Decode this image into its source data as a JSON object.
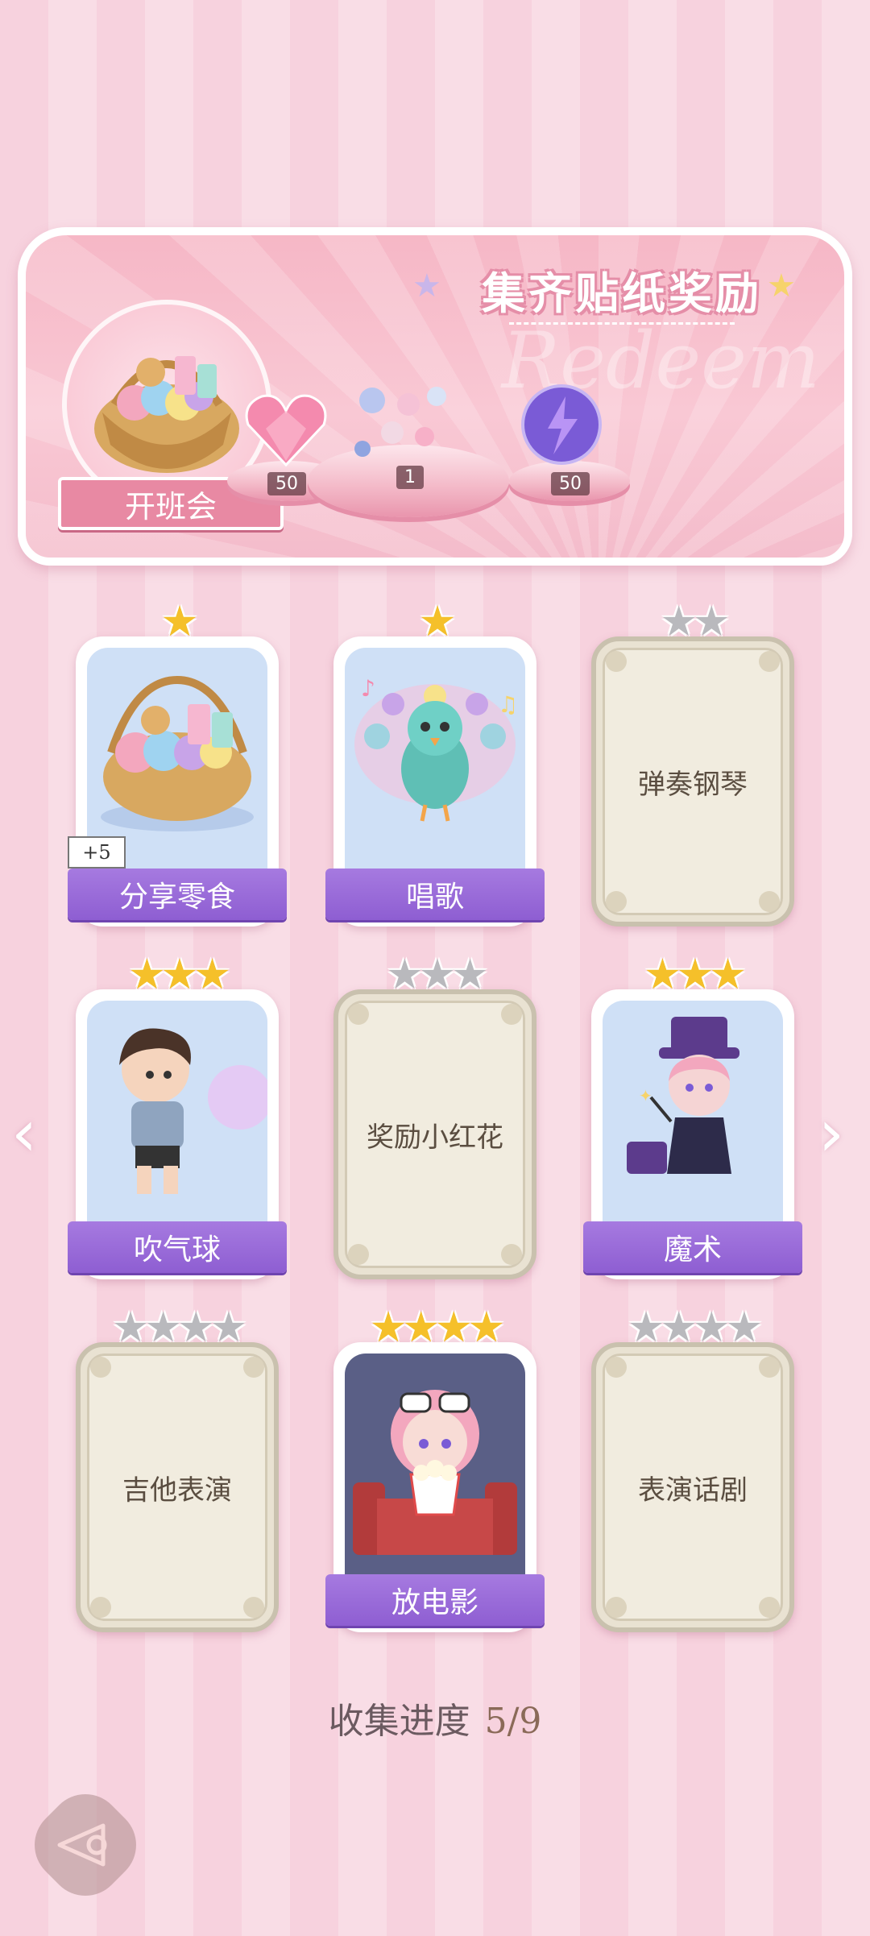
{
  "banner": {
    "title": "集齐贴纸奖励",
    "watermark": "Redeem",
    "event_label": "开班会",
    "rewards": [
      {
        "icon": "heart-gem-icon",
        "count": "50"
      },
      {
        "icon": "candy-bundle-icon",
        "count": "1"
      },
      {
        "icon": "energy-orb-icon",
        "count": "50"
      }
    ]
  },
  "cards": [
    {
      "label": "分享零食",
      "stars": 1,
      "total_stars": 1,
      "unlocked": true,
      "badge": "+5",
      "icon": "snack-basket-icon"
    },
    {
      "label": "唱歌",
      "stars": 1,
      "total_stars": 1,
      "unlocked": true,
      "icon": "singing-peacock-icon"
    },
    {
      "label": "弹奏钢琴",
      "stars": 0,
      "total_stars": 2,
      "unlocked": false
    },
    {
      "label": "吹气球",
      "stars": 3,
      "total_stars": 3,
      "unlocked": true,
      "icon": "boy-balloon-icon"
    },
    {
      "label": "奖励小红花",
      "stars": 0,
      "total_stars": 3,
      "unlocked": false
    },
    {
      "label": "魔术",
      "stars": 3,
      "total_stars": 3,
      "unlocked": true,
      "icon": "magician-girl-icon"
    },
    {
      "label": "吉他表演",
      "stars": 0,
      "total_stars": 4,
      "unlocked": false
    },
    {
      "label": "放电影",
      "stars": 4,
      "total_stars": 4,
      "unlocked": true,
      "icon": "movie-girl-icon"
    },
    {
      "label": "表演话剧",
      "stars": 0,
      "total_stars": 4,
      "unlocked": false
    }
  ],
  "progress": {
    "label": "收集进度",
    "value": "5/9"
  },
  "colors": {
    "label_purple": "#8e5ed2",
    "star_gold": "#f5c02a",
    "star_gray": "#b9b9bd",
    "banner_pink": "#f6b7c6"
  }
}
